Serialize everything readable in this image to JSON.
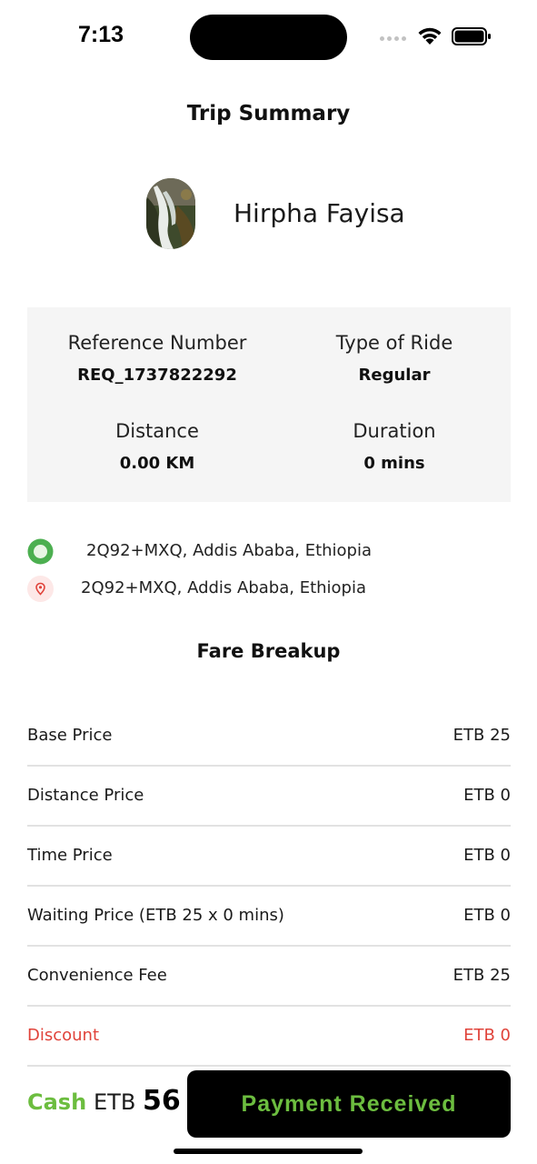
{
  "status_bar": {
    "time": "7:13",
    "icons": [
      "signal-dots-icon",
      "wifi-icon",
      "battery-icon"
    ]
  },
  "page": {
    "title": "Trip Summary"
  },
  "driver": {
    "name": "Hirpha Fayisa",
    "avatar": "waterfall-photo"
  },
  "trip_info": {
    "reference_label": "Reference Number",
    "reference_value": "REQ_1737822292",
    "ride_type_label": "Type of Ride",
    "ride_type_value": "Regular",
    "distance_label": "Distance",
    "distance_value": "0.00 KM",
    "duration_label": "Duration",
    "duration_value": "0 mins"
  },
  "locations": {
    "pickup": "2Q92+MXQ, Addis Ababa, Ethiopia",
    "drop": "2Q92+MXQ, Addis Ababa, Ethiopia",
    "pickup_icon": "pickup-dot-icon",
    "drop_icon": "map-pin-icon"
  },
  "fare": {
    "title": "Fare Breakup",
    "items": [
      {
        "label": "Base Price",
        "value": "ETB 25"
      },
      {
        "label": "Distance Price",
        "value": "ETB 0"
      },
      {
        "label": "Time Price",
        "value": "ETB 0"
      },
      {
        "label": "Waiting Price (ETB 25 x 0 mins)",
        "value": "ETB 0"
      },
      {
        "label": "Convenience Fee",
        "value": "ETB 25"
      },
      {
        "label": "Discount",
        "value": "ETB 0"
      }
    ]
  },
  "footer": {
    "payment_method": "Cash",
    "currency": "ETB",
    "total": "56",
    "button_label": "Payment Received"
  },
  "colors": {
    "accent_green": "#6cbd3f",
    "discount_red": "#e0433a",
    "card_background": "#f5f5f5",
    "button_background": "#000000"
  }
}
